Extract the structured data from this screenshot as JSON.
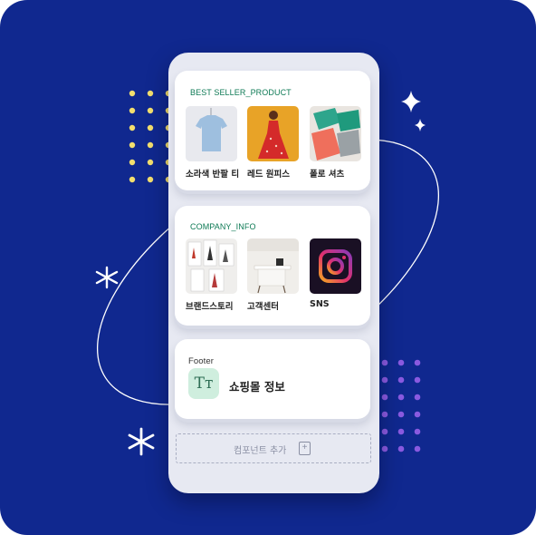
{
  "colors": {
    "background": "#10288f",
    "accent_green": "#0e7a55",
    "dot_yellow": "#f3df6e",
    "dot_purple": "#8a5ae0"
  },
  "best_seller": {
    "label": "BEST SELLER_PRODUCT",
    "items": [
      {
        "caption": "소라색 반팔 티",
        "image": "blue-tshirt"
      },
      {
        "caption": "레드 원피스",
        "image": "red-dress"
      },
      {
        "caption": "폴로 셔츠",
        "image": "polo-shirts"
      }
    ]
  },
  "company_info": {
    "label": "COMPANY_INFO",
    "items": [
      {
        "caption": "브랜드스토리",
        "image": "fashion-sketches"
      },
      {
        "caption": "고객센터",
        "image": "reception-desk"
      },
      {
        "caption": "SNS",
        "image": "instagram-logo"
      }
    ]
  },
  "footer": {
    "label": "Footer",
    "icon": "text-icon",
    "title": "쇼핑몰 정보"
  },
  "add_component": {
    "label": "컴포넌트 추가",
    "icon": "plus-square-icon"
  }
}
